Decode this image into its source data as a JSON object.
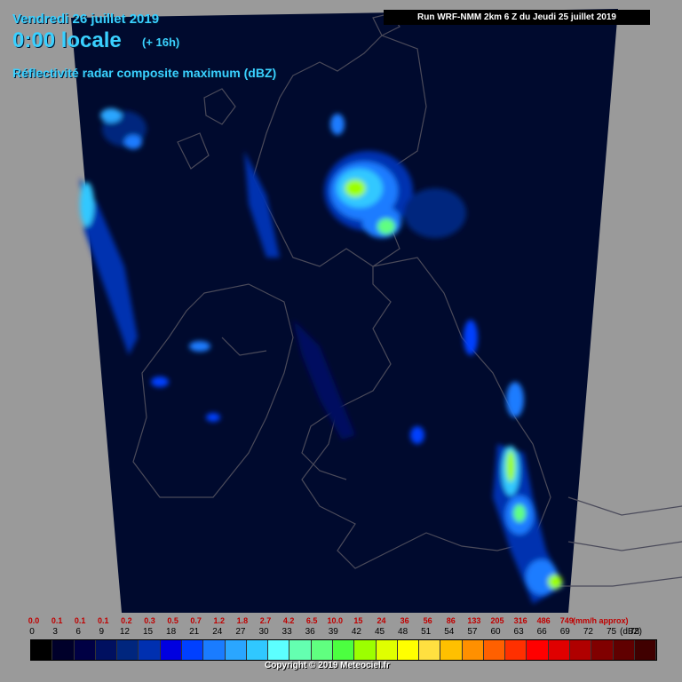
{
  "header": {
    "date": "Vendredi 26 juillet 2019",
    "hour": "0:00 locale",
    "offset": "(+ 16h)",
    "parameter": "Réflectivité radar composite maximum (dBZ)",
    "run": "Run WRF-NMM 2km 6 Z du Jeudi 25 juillet 2019"
  },
  "legend": {
    "mm_values": [
      "0.0",
      "0.1",
      "0.1",
      "0.1",
      "0.2",
      "0.3",
      "0.5",
      "0.7",
      "1.2",
      "1.8",
      "2.7",
      "4.2",
      "6.5",
      "10.0",
      "15",
      "24",
      "36",
      "56",
      "86",
      "133",
      "205",
      "316",
      "486",
      "749"
    ],
    "mm_unit": "(mm/h approx)",
    "dbz_values": [
      "0",
      "3",
      "6",
      "9",
      "12",
      "15",
      "18",
      "21",
      "24",
      "27",
      "30",
      "33",
      "36",
      "39",
      "42",
      "45",
      "48",
      "51",
      "54",
      "57",
      "60",
      "63",
      "66",
      "69",
      "72",
      "75",
      "78"
    ],
    "dbz_unit": "(dBZ)",
    "colors": [
      "#000000",
      "#00002a",
      "#000044",
      "#001060",
      "#00267e",
      "#0030b0",
      "#0000e0",
      "#0040ff",
      "#1a7cff",
      "#2aa6ff",
      "#30c8ff",
      "#5cffff",
      "#64ffb0",
      "#60ff80",
      "#4cff40",
      "#9cff00",
      "#e0ff00",
      "#ffff00",
      "#ffe040",
      "#ffc000",
      "#ff9000",
      "#ff6000",
      "#ff3000",
      "#ff0000",
      "#e00000",
      "#b00000",
      "#800000",
      "#600000",
      "#400000"
    ]
  },
  "copyright": "Copyright © 2019 Meteociel.fr"
}
